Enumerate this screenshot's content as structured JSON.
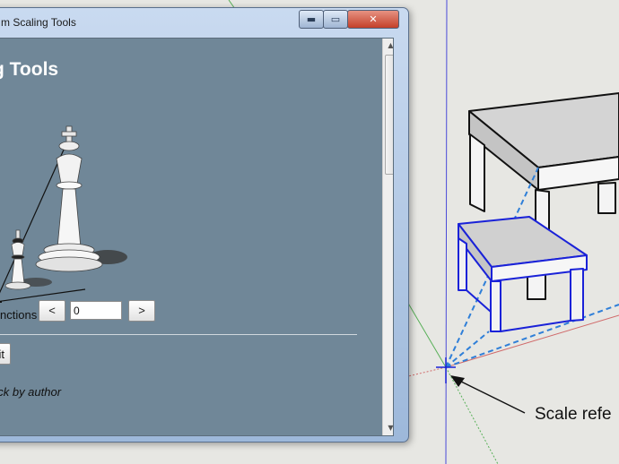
{
  "dialog": {
    "title": "m Scaling Tools",
    "window_buttons": {
      "minimize": "▬",
      "maximize": "▭",
      "close": "✕"
    },
    "heading": "g Tools",
    "functions_label": "nctions",
    "prev_label": "<",
    "next_label": ">",
    "counter_value": "0",
    "exit_label": "xit",
    "feedback_text": "ack by author"
  },
  "scrollbar": {
    "up": "▲",
    "down": "▼"
  },
  "viewport": {
    "annotation_label": "Scale refe"
  },
  "colors": {
    "dialog_bg": "#708798",
    "selection_blue": "#1a22d8",
    "guide_dashed": "#2f7fd8",
    "axis_red": "#d06a6a",
    "axis_green": "#58b058",
    "axis_blue": "#4a4ad8"
  }
}
